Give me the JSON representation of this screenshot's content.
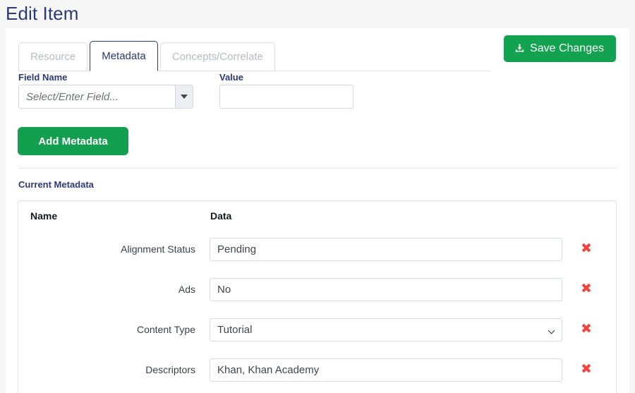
{
  "page": {
    "title": "Edit Item",
    "title_color": "#2b3a77",
    "background": "#f7f7f7"
  },
  "tabs": [
    {
      "label": "Resource",
      "active": false
    },
    {
      "label": "Metadata",
      "active": true
    },
    {
      "label": "Concepts/Correlate",
      "active": false
    }
  ],
  "toolbar": {
    "save_label": "Save Changes",
    "save_icon": "download-icon",
    "save_color": "#13a350"
  },
  "form": {
    "field_name_label": "Field Name",
    "field_name_placeholder": "Select/Enter Field...",
    "field_name_value": "",
    "field_name_dropdown_icon": "caret-down-icon",
    "value_label": "Value",
    "value_value": "",
    "value_placeholder": "",
    "add_button_label": "Add Metadata",
    "add_button_color": "#12a04f"
  },
  "current_metadata": {
    "section_title": "Current Metadata",
    "columns": [
      "Name",
      "Data"
    ],
    "delete_icon": "delete-x-icon",
    "delete_icon_glyph": "✖",
    "delete_icon_color": "#f4433c",
    "rows": [
      {
        "name": "Alignment Status",
        "value": "Pending",
        "control": "text"
      },
      {
        "name": "Ads",
        "value": "No",
        "control": "text"
      },
      {
        "name": "Content Type",
        "value": "Tutorial",
        "control": "select",
        "options": [
          "Tutorial"
        ]
      },
      {
        "name": "Descriptors",
        "value": "Khan, Khan Academy",
        "control": "text"
      }
    ]
  }
}
